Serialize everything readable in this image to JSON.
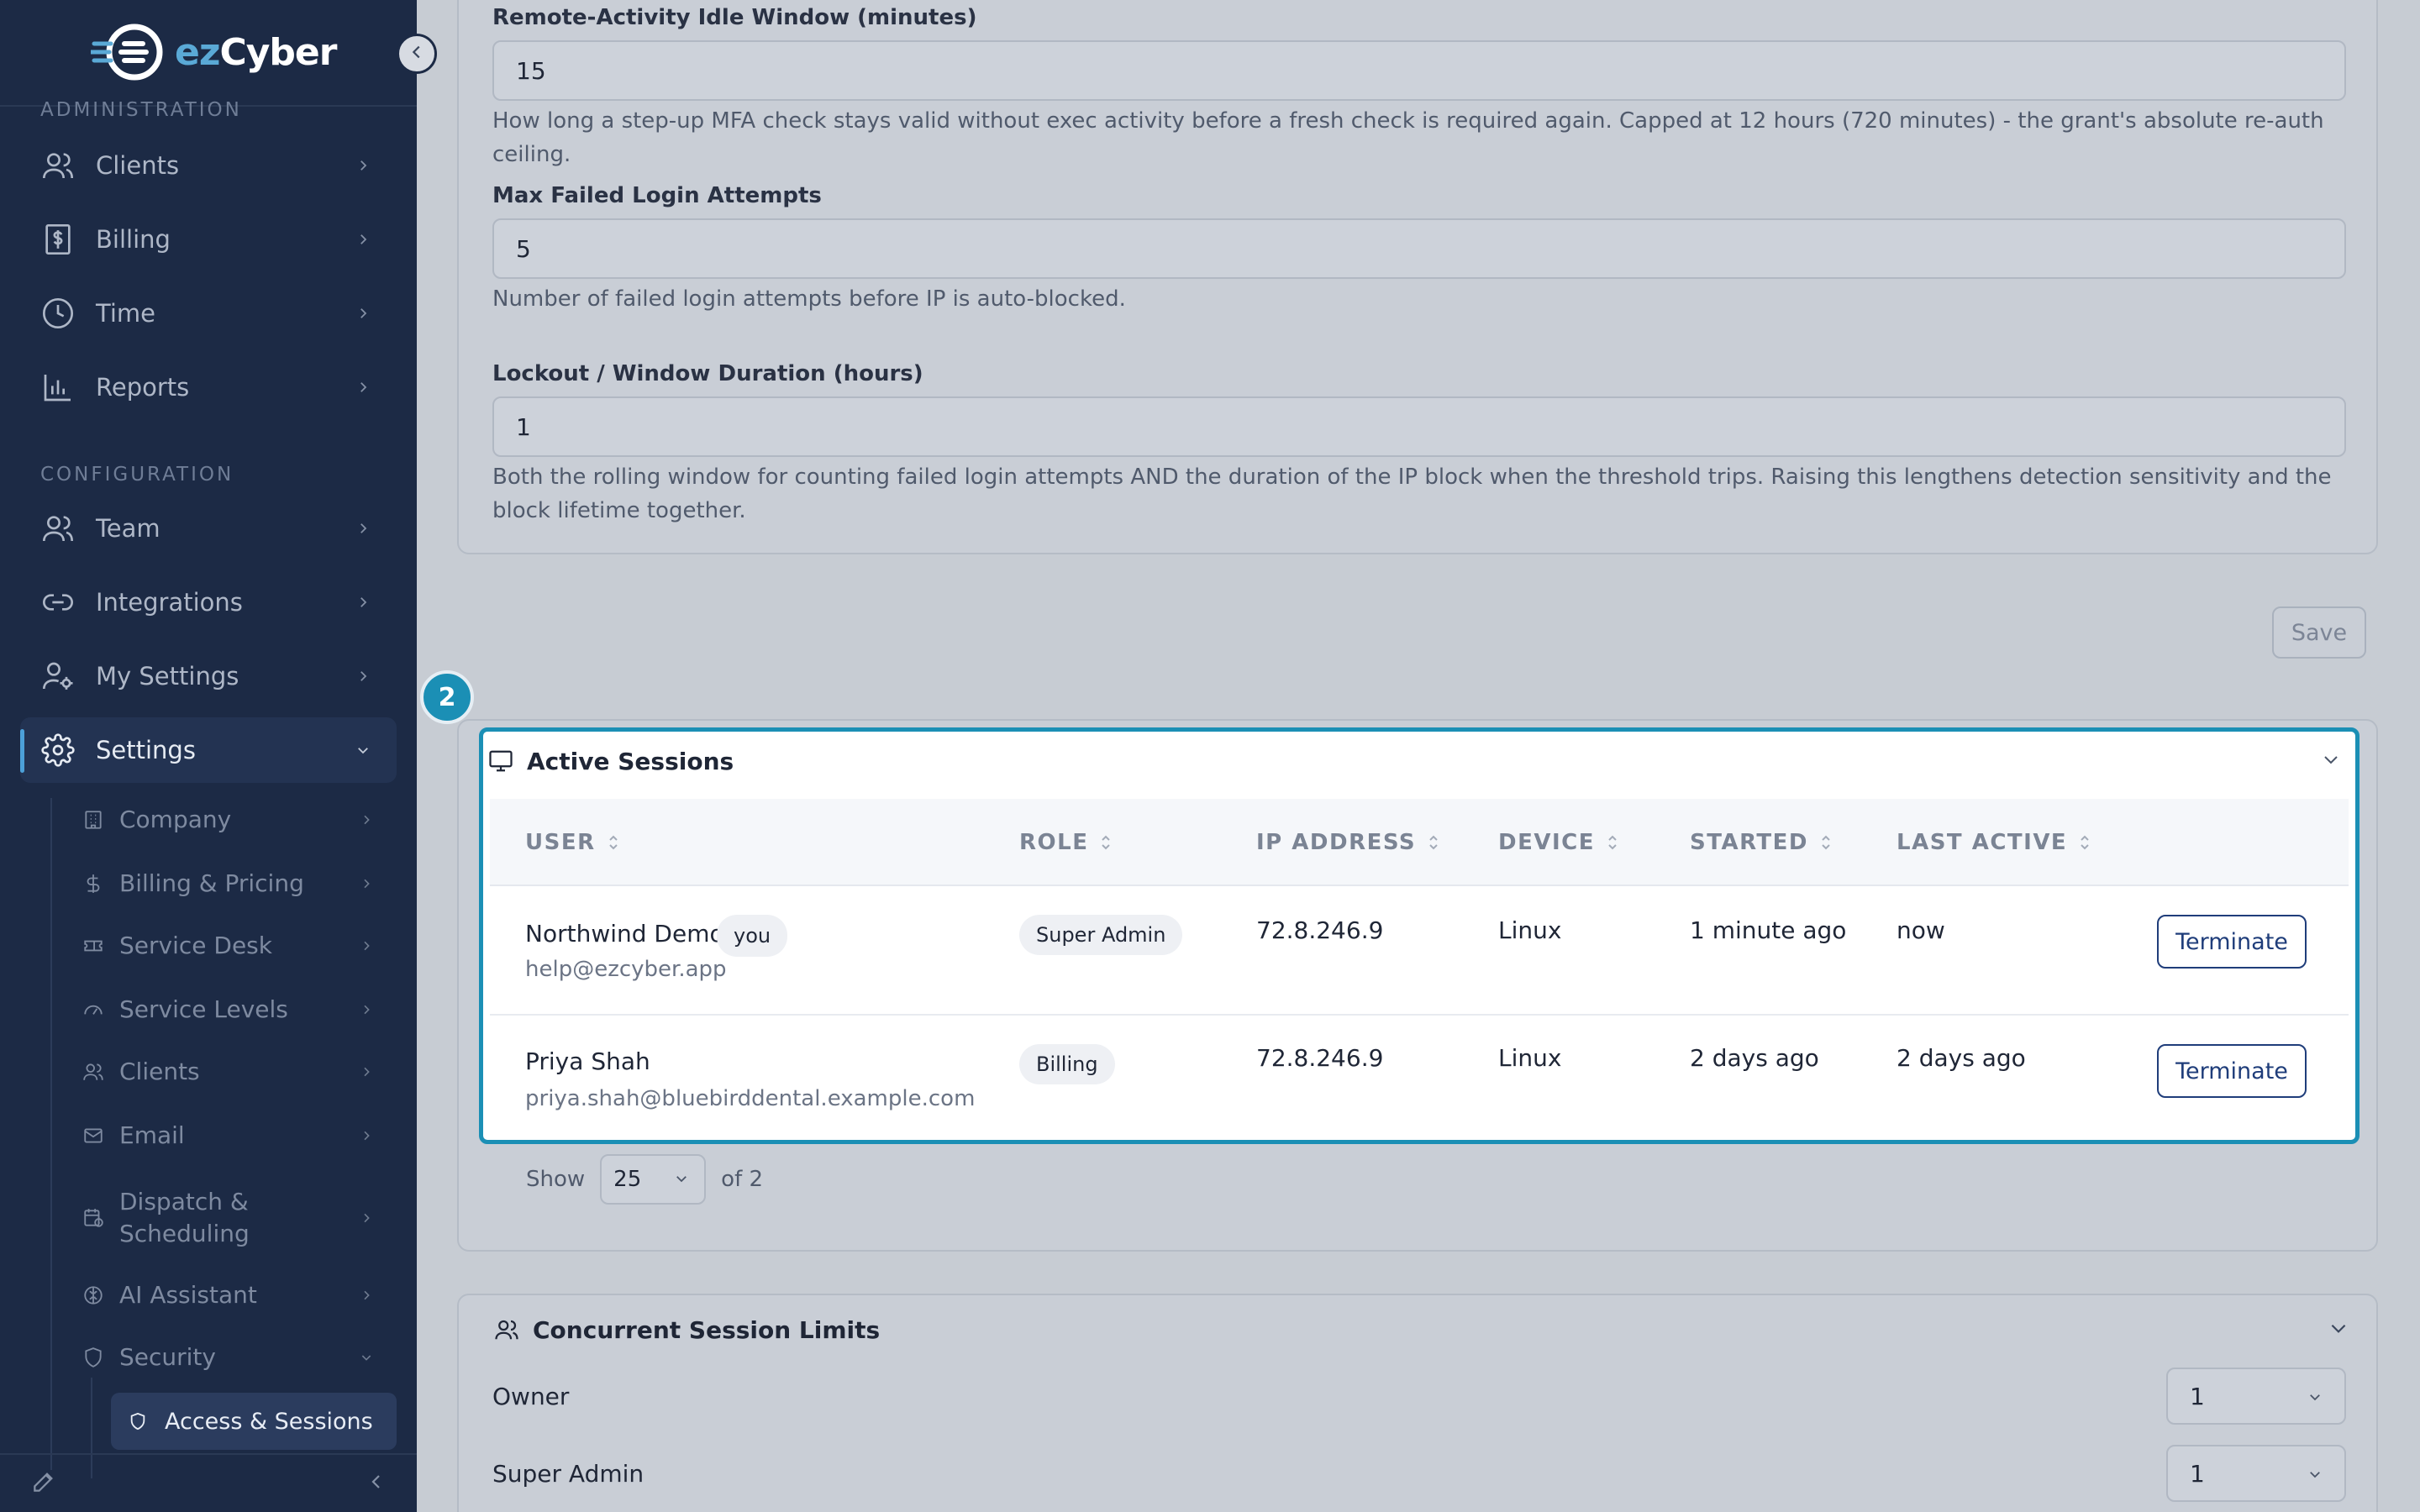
{
  "brand": {
    "logo_prefix": "ez",
    "logo_suffix": "Cyber"
  },
  "sidebar": {
    "section_admin": "ADMINISTRATION",
    "section_config": "CONFIGURATION",
    "items": [
      {
        "label": "Clients"
      },
      {
        "label": "Billing"
      },
      {
        "label": "Time"
      },
      {
        "label": "Reports"
      },
      {
        "label": "Team"
      },
      {
        "label": "Integrations"
      },
      {
        "label": "My Settings"
      },
      {
        "label": "Settings"
      }
    ],
    "sub_items": [
      {
        "label": "Company"
      },
      {
        "label": "Billing & Pricing"
      },
      {
        "label": "Service Desk"
      },
      {
        "label": "Service Levels"
      },
      {
        "label": "Clients"
      },
      {
        "label": "Email"
      },
      {
        "label": "Dispatch & Scheduling"
      },
      {
        "label": "AI Assistant"
      },
      {
        "label": "Security"
      }
    ],
    "active_sub": "Access & Sessions"
  },
  "security_form": {
    "idle_label": "Remote-Activity Idle Window (minutes)",
    "idle_value": "15",
    "idle_help": "How long a step-up MFA check stays valid without exec activity before a fresh check is required again. Capped at 12 hours (720 minutes) - the grant's absolute re-auth ceiling.",
    "max_label": "Max Failed Login Attempts",
    "max_value": "5",
    "max_help": "Number of failed login attempts before IP is auto-blocked.",
    "lockout_label": "Lockout / Window Duration (hours)",
    "lockout_value": "1",
    "lockout_help": "Both the rolling window for counting failed login attempts AND the duration of the IP block when the threshold trips. Raising this lengthens detection sensitivity and the block lifetime together.",
    "save_label": "Save"
  },
  "step_badge": "2",
  "sessions": {
    "title": "Active Sessions",
    "columns": [
      "USER",
      "ROLE",
      "IP ADDRESS",
      "DEVICE",
      "STARTED",
      "LAST ACTIVE"
    ],
    "rows": [
      {
        "name": "Northwind Demo",
        "tag": "you",
        "email": "help@ezcyber.app",
        "role": "Super Admin",
        "ip": "72.8.246.9",
        "device": "Linux",
        "started": "1 minute ago",
        "last_active": "now",
        "action": "Terminate"
      },
      {
        "name": "Priya Shah",
        "tag": "",
        "email": "priya.shah@bluebirddental.example.com",
        "role": "Billing",
        "ip": "72.8.246.9",
        "device": "Linux",
        "started": "2 days ago",
        "last_active": "2 days ago",
        "action": "Terminate"
      }
    ],
    "pager": {
      "show_label": "Show",
      "page_size": "25",
      "of_label": "of 2"
    }
  },
  "concurrent": {
    "title": "Concurrent Session Limits",
    "rows": [
      {
        "label": "Owner",
        "value": "1"
      },
      {
        "label": "Super Admin",
        "value": "1"
      }
    ]
  },
  "colors": {
    "sidebar_bg": "#1c2a45",
    "accent": "#1b8fb5",
    "button_border": "#1f3d7a"
  }
}
